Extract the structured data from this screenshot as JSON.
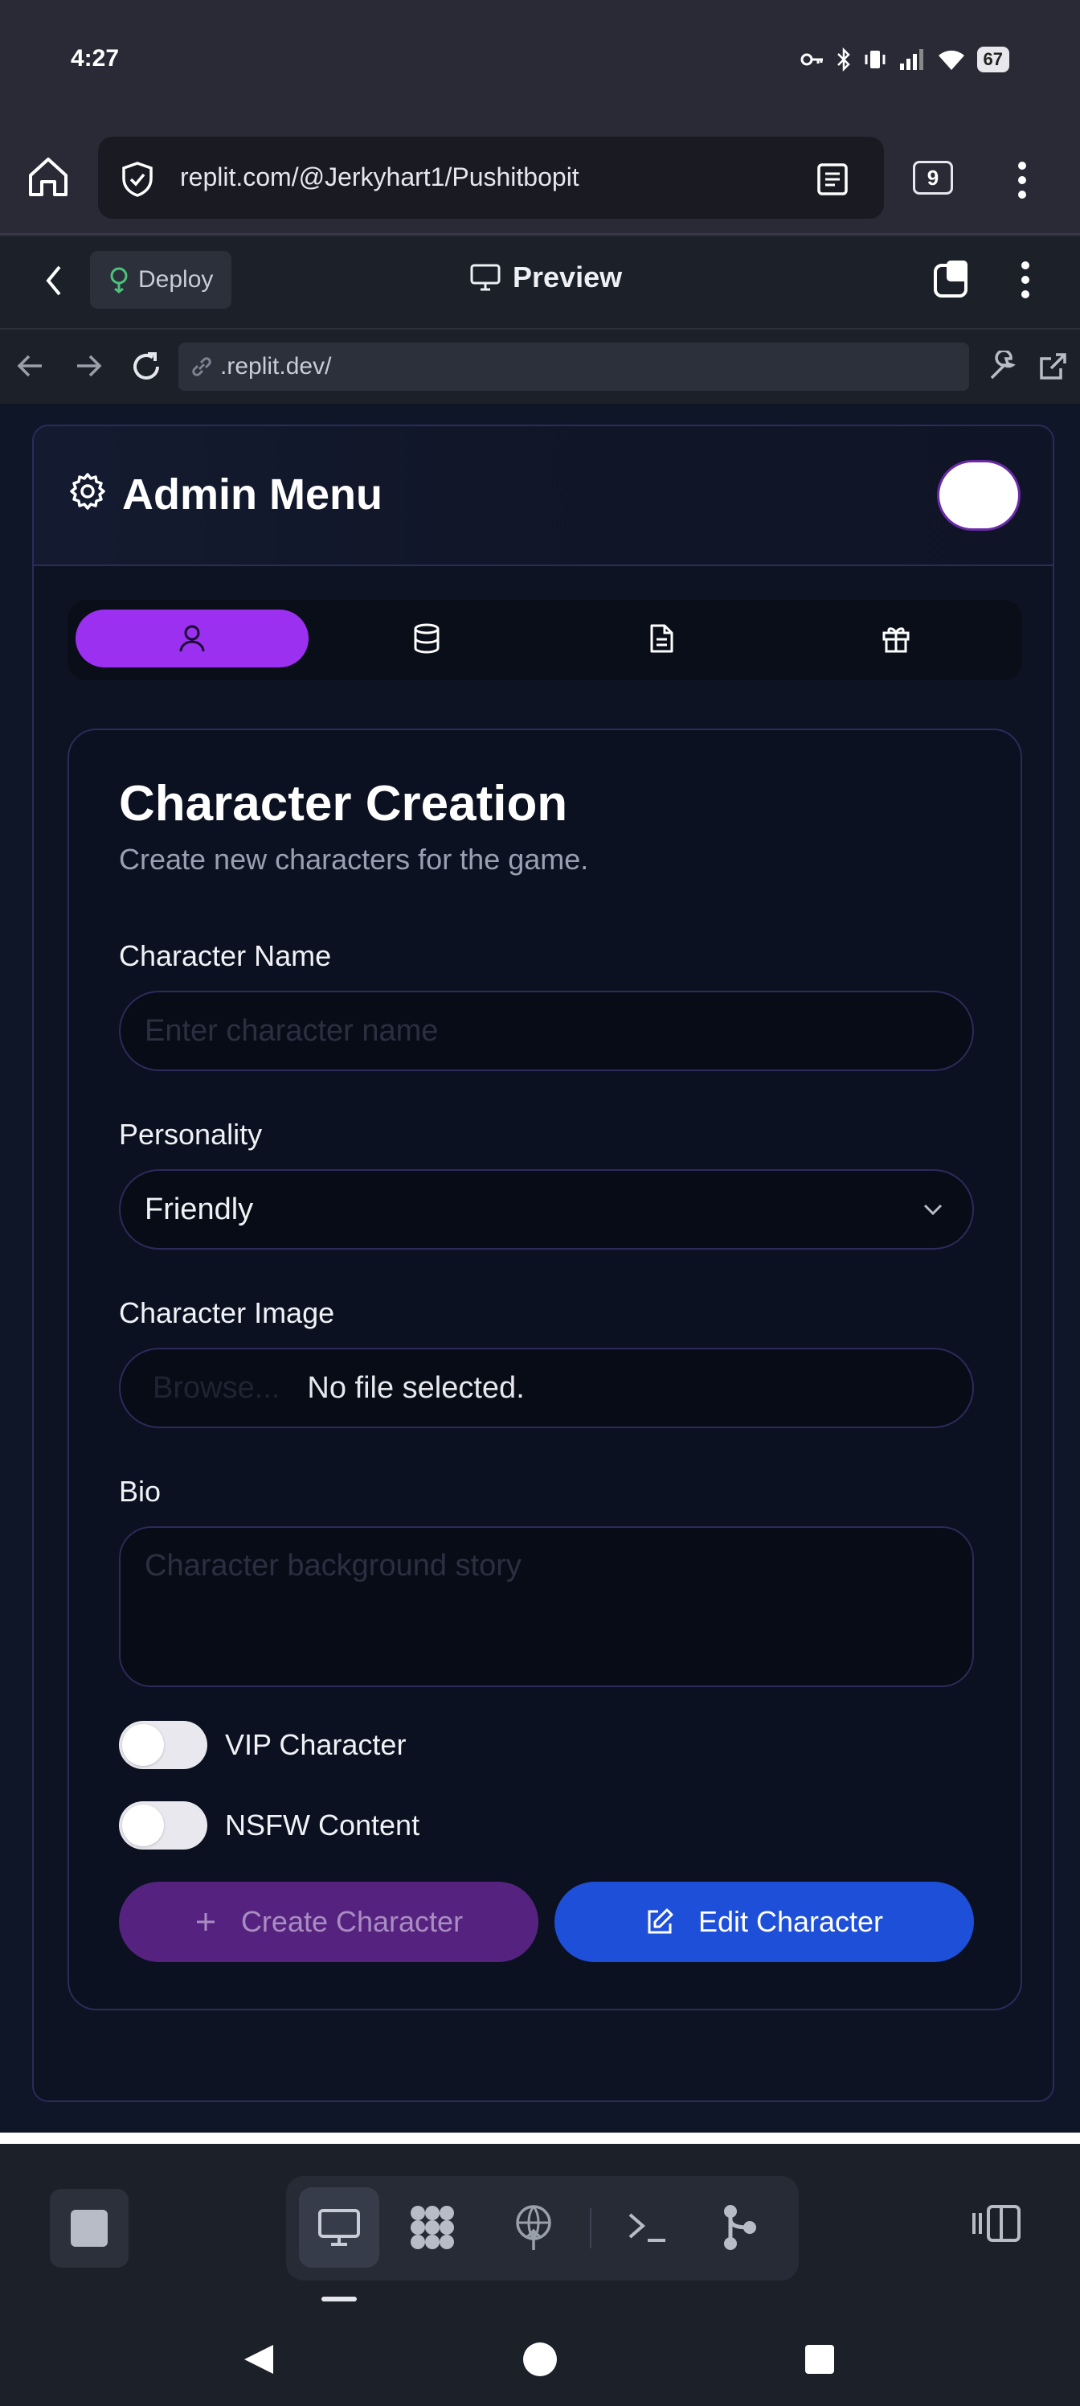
{
  "status_bar": {
    "time": "4:27",
    "battery": "67"
  },
  "browser": {
    "url": "replit.com/@Jerkyhart1/Pushitbopit",
    "tab_count": "9"
  },
  "replit_bar": {
    "deploy_label": "Deploy",
    "preview_label": "Preview"
  },
  "webview_address": {
    "url": ".replit.dev/"
  },
  "admin": {
    "title": "Admin Menu",
    "tabs": [
      "user-icon",
      "database-icon",
      "document-icon",
      "gift-icon"
    ],
    "active_tab": 0
  },
  "card": {
    "title": "Character Creation",
    "description": "Create new characters for the game.",
    "name_label": "Character Name",
    "name_placeholder": "Enter character name",
    "personality_label": "Personality",
    "personality_value": "Friendly",
    "image_label": "Character Image",
    "file_browse": "Browse...",
    "file_status": "No file selected.",
    "bio_label": "Bio",
    "bio_placeholder": "Character background story",
    "vip_label": "VIP Character",
    "nsfw_label": "NSFW Content",
    "create_button": "Create Character",
    "edit_button": "Edit Character"
  },
  "colors": {
    "accent_purple": "#9b30f0",
    "edit_blue": "#1e4fd8",
    "create_purple": "#55237f"
  }
}
